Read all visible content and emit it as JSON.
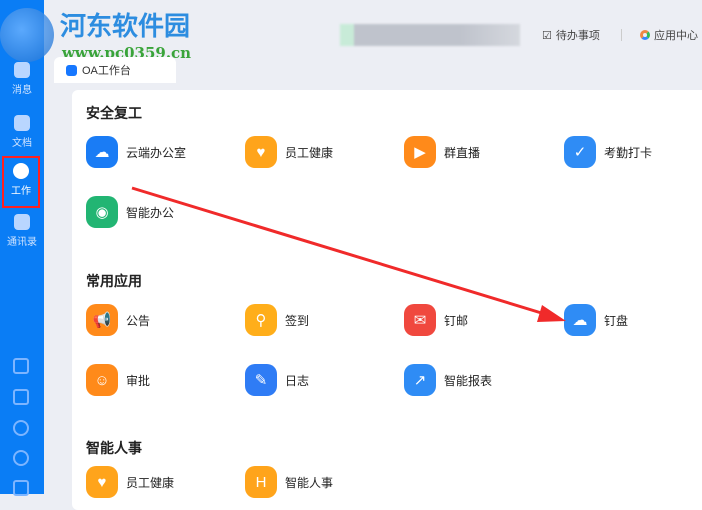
{
  "watermark": {
    "title": "河东软件园",
    "url": "www.pc0359.cn"
  },
  "sidebar": {
    "items": [
      {
        "label": "消息"
      },
      {
        "label": "文档"
      },
      {
        "label": "工作"
      },
      {
        "label": "通讯录"
      }
    ]
  },
  "tab": {
    "label": "OA工作台"
  },
  "header": {
    "todo": "待办事项",
    "appcenter": "应用中心"
  },
  "sections": [
    {
      "title": "安全复工",
      "apps": [
        {
          "label": "云端办公室",
          "color": "#1a7cf5"
        },
        {
          "label": "员工健康",
          "color": "#ffa41b"
        },
        {
          "label": "群直播",
          "color": "#ff8a1a"
        },
        {
          "label": "考勤打卡",
          "color": "#2f8cf5"
        },
        {
          "label": "智能办公",
          "color": "#22b573"
        }
      ]
    },
    {
      "title": "常用应用",
      "apps": [
        {
          "label": "公告",
          "color": "#ff8a1a"
        },
        {
          "label": "签到",
          "color": "#ffae1a"
        },
        {
          "label": "钉邮",
          "color": "#f0483e"
        },
        {
          "label": "钉盘",
          "color": "#2f8cf5"
        },
        {
          "label": "审批",
          "color": "#ff8a1a"
        },
        {
          "label": "日志",
          "color": "#2f7cf5"
        },
        {
          "label": "智能报表",
          "color": "#2f8cf5"
        }
      ]
    },
    {
      "title": "智能人事",
      "apps": [
        {
          "label": "员工健康",
          "color": "#ffa41b"
        },
        {
          "label": "智能人事",
          "color": "#ffa41b"
        }
      ]
    }
  ]
}
